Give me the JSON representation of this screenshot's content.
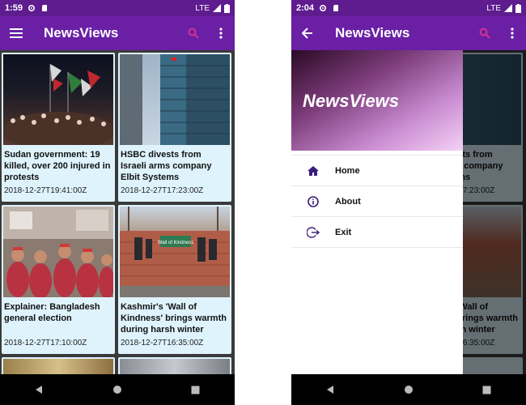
{
  "left": {
    "status": {
      "time": "1:59",
      "network": "LTE"
    },
    "appbar": {
      "title": "NewsViews"
    },
    "articles": [
      {
        "headline": "Sudan government: 19 killed, over 200 injured in protests",
        "date": "2018-12-27T19:41:00Z"
      },
      {
        "headline": "HSBC divests from Israeli arms company Elbit Systems",
        "date": "2018-12-27T17:23:00Z"
      },
      {
        "headline": "Explainer: Bangladesh general election",
        "date": "2018-12-27T17:10:00Z"
      },
      {
        "headline": "Kashmir's 'Wall of Kindness' brings warmth during harsh winter",
        "date": "2018-12-27T16:35:00Z"
      }
    ],
    "photo_text": {
      "wall_sign": "Wall of Kindness"
    }
  },
  "right": {
    "status": {
      "time": "2:04",
      "network": "LTE"
    },
    "appbar": {
      "title": "NewsViews"
    },
    "drawer": {
      "title": "NewsViews",
      "items": [
        {
          "label": "Home",
          "icon": "home-icon"
        },
        {
          "label": "About",
          "icon": "info-icon"
        },
        {
          "label": "Exit",
          "icon": "exit-icon"
        }
      ]
    }
  },
  "colors": {
    "statusbar": "#5e1c8f",
    "appbar": "#6a1fa5",
    "card": "#dff3fd",
    "search_icon": "#d6318f"
  }
}
